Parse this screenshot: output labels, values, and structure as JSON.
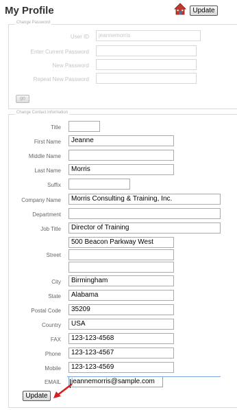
{
  "header": {
    "title": "My Profile",
    "update_label": "Update",
    "home_icon": "home-icon"
  },
  "password_section": {
    "legend": "Change Password",
    "user_id_label": "User ID",
    "user_id_value": "jeannemorris",
    "current_password_label": "Enter Current Password",
    "new_password_label": "New Password",
    "repeat_password_label": "Repeat New Password",
    "go_label": "go"
  },
  "contact_section": {
    "legend": "Change Contact Information",
    "fields": {
      "title": {
        "label": "Title",
        "value": ""
      },
      "first_name": {
        "label": "First Name",
        "value": "Jeanne"
      },
      "middle_name": {
        "label": "Middle Name",
        "value": ""
      },
      "last_name": {
        "label": "Last Name",
        "value": "Morris"
      },
      "suffix": {
        "label": "Suffix",
        "value": ""
      },
      "company": {
        "label": "Company Name",
        "value": "Morris Consulting & Training, Inc."
      },
      "department": {
        "label": "Department",
        "value": ""
      },
      "job_title": {
        "label": "Job Title",
        "value": "Director of Training"
      },
      "street": {
        "label": "Street",
        "line1": "500 Beacon Parkway West",
        "line2": "",
        "line3": ""
      },
      "city": {
        "label": "City",
        "value": "Birmingham"
      },
      "state": {
        "label": "State",
        "value": "Alabama"
      },
      "postal_code": {
        "label": "Postal Code",
        "value": "35209"
      },
      "country": {
        "label": "Country",
        "value": "USA"
      },
      "fax": {
        "label": "FAX",
        "value": "123-123-4568"
      },
      "phone": {
        "label": "Phone",
        "value": "123-123-4567"
      },
      "mobile": {
        "label": "Mobile",
        "value": "123-123-4569"
      },
      "email": {
        "label": "EMAIL",
        "value": "jeannemorris@sample.com"
      }
    },
    "update_label": "Update"
  },
  "colors": {
    "arrow": "#d42020",
    "accent": "#7aa7d8"
  }
}
